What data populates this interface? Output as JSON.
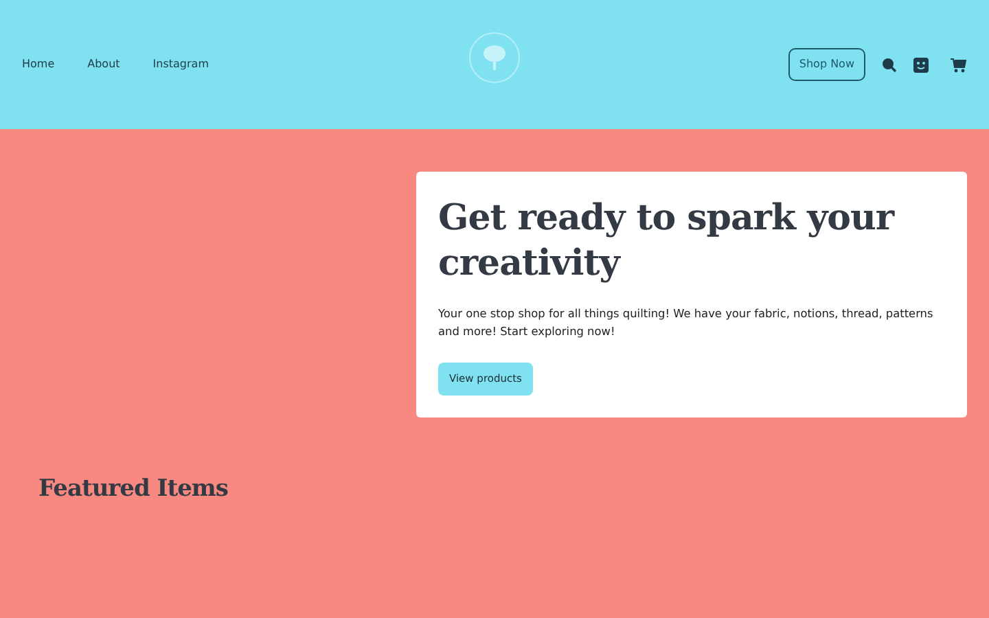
{
  "nav": {
    "links": [
      "Home",
      "About",
      "Instagram"
    ],
    "shop_button": "Shop Now"
  },
  "hero": {
    "title": "Get ready to spark your creativity",
    "text": "Your one stop shop for all things quilting! We have your fabric, notions, thread, patterns and more! Start exploring now!",
    "button": "View products"
  },
  "featured": {
    "heading": "Featured Items"
  }
}
